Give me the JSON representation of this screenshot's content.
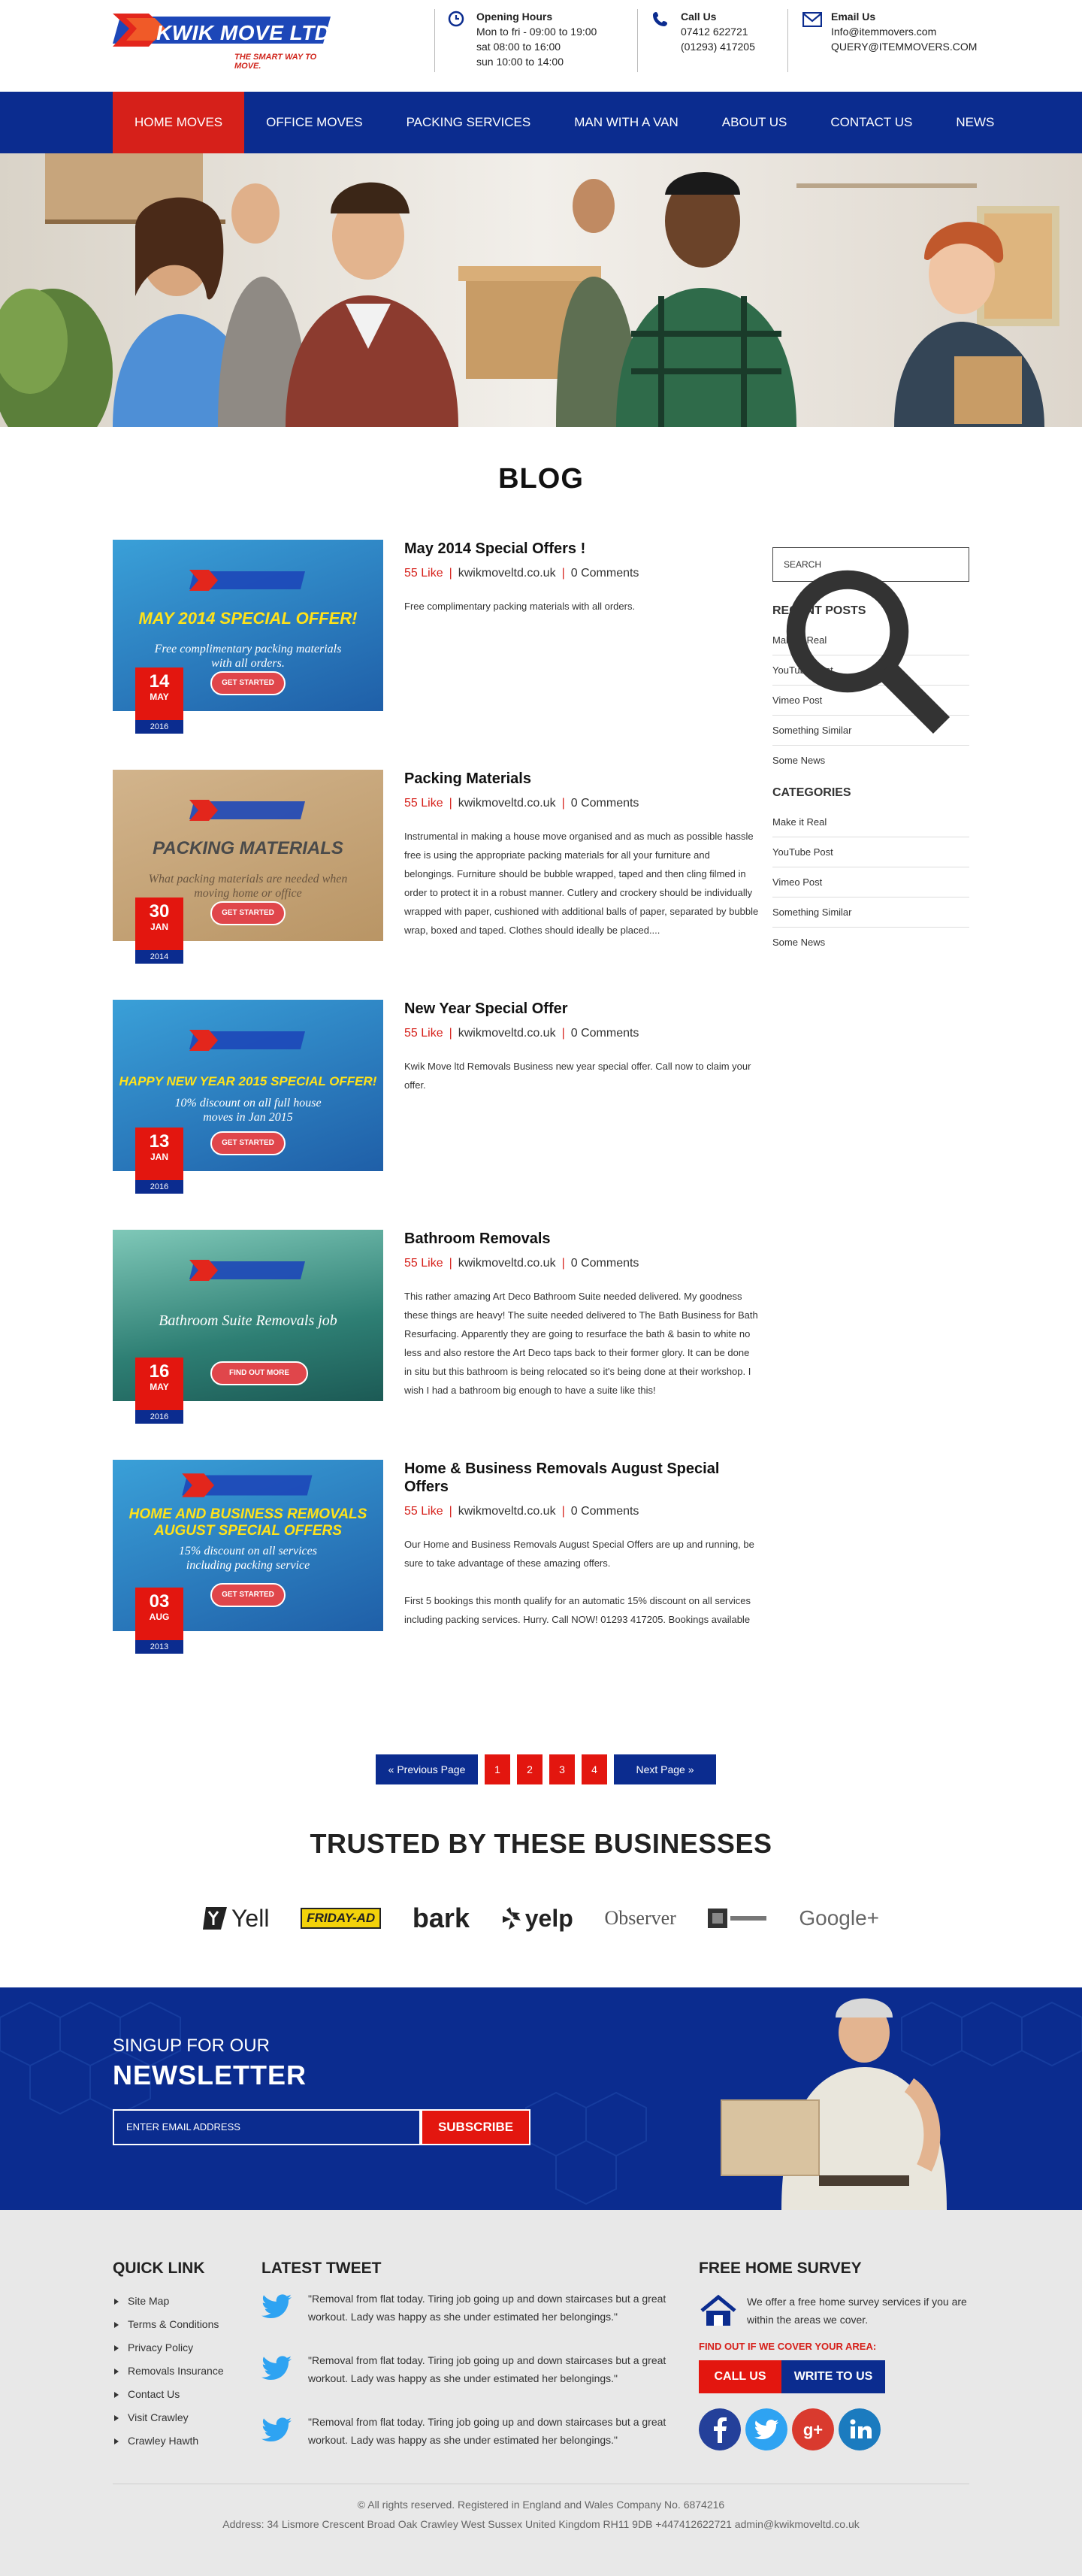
{
  "header": {
    "logo_text": "KWIK MOVE LTD",
    "logo_tagline": "THE SMART WAY TO MOVE.",
    "hours": {
      "title": "Opening Hours",
      "lines": [
        "Mon to fri - 09:00  to 19:00",
        "sat 08:00  to 16:00",
        "sun 10:00 to 14:00"
      ]
    },
    "call": {
      "title": "Call Us",
      "lines": [
        "07412 622721",
        "(01293) 417205"
      ]
    },
    "email": {
      "title": "Email Us",
      "lines": [
        "Info@itemmovers.com",
        "QUERY@ITEMMOVERS.COM"
      ]
    }
  },
  "nav": [
    "HOME MOVES",
    "OFFICE MOVES",
    "PACKING SERVICES",
    "MAN WITH A VAN",
    "ABOUT US",
    "CONTACT US",
    "NEWS"
  ],
  "blog_title": "BLOG",
  "posts": [
    {
      "title": "May 2014 Special Offers !",
      "likes": "55 Like",
      "site": "kwikmoveltd.co.uk",
      "comments": "0 Comments",
      "excerpt": "Free complimentary packing materials with all orders.",
      "img_logo": "KWIK MOVE LTD",
      "img_headline": "MAY 2014 SPECIAL OFFER!",
      "img_sub": "Free complimentary packing materials with all orders.",
      "img_cta": "GET STARTED",
      "day": "14",
      "month": "MAY",
      "year": "2016"
    },
    {
      "title": "Packing Materials",
      "likes": "55 Like",
      "site": "kwikmoveltd.co.uk",
      "comments": "0 Comments",
      "excerpt": "Instrumental in making a house move organised and as much as possible hassle free is using the appropriate packing materials for all your furniture and belongings. Furniture should be bubble wrapped, taped and then cling filmed in order to protect it in a robust manner. Cutlery and crockery should be individually wrapped with paper, cushioned with additional balls of paper, separated by bubble wrap, boxed and taped. Clothes should ideally be placed....",
      "img_logo": "KWIK MOVE LTD",
      "img_headline": "PACKING MATERIALS",
      "img_sub": "What packing materials are needed when moving home or office",
      "img_cta": "GET STARTED",
      "day": "30",
      "month": "JAN",
      "year": "2014"
    },
    {
      "title": "New Year Special Offer",
      "likes": "55 Like",
      "site": "kwikmoveltd.co.uk",
      "comments": "0 Comments",
      "excerpt": "Kwik Move ltd Removals Business new year special offer. Call now to claim your offer.",
      "img_logo": "KWIK MOVE LTD",
      "img_headline": "HAPPY NEW YEAR 2015 SPECIAL OFFER!",
      "img_sub": "10% discount on all full house moves in Jan 2015",
      "img_cta": "GET STARTED",
      "day": "13",
      "month": "JAN",
      "year": "2016"
    },
    {
      "title": "Bathroom Removals",
      "likes": "55 Like",
      "site": "kwikmoveltd.co.uk",
      "comments": "0 Comments",
      "excerpt": "This rather amazing Art Deco Bathroom Suite needed delivered. My goodness these things are heavy! The suite needed delivered to The Bath Business for Bath Resurfacing. Apparently they are going to resurface the bath & basin to white no less and also restore the Art Deco taps back to their former glory. It can be done in situ but this bathroom is being relocated so it's being done at their workshop. I wish I had a bathroom big enough to have a suite like this!",
      "img_logo": "KWIK MOVE LTD",
      "img_headline": "",
      "img_sub": "Bathroom Suite Removals job",
      "img_cta": "FIND OUT MORE",
      "day": "16",
      "month": "MAY",
      "year": "2016"
    },
    {
      "title": "Home & Business Removals August Special Offers",
      "likes": "55 Like",
      "site": "kwikmoveltd.co.uk",
      "comments": "0 Comments",
      "excerpt": "Our Home and Business Removals August Special Offers are up and running, be sure to take advantage of these amazing offers.",
      "excerpt2": "First 5 bookings this month qualify for an automatic 15% discount on all services including packing services. Hurry. Call NOW! 01293 417205. Bookings available",
      "img_logo": "KWIK MOVE LTD",
      "img_headline": "HOME AND BUSINESS REMOVALS AUGUST SPECIAL OFFERS",
      "img_sub": "15% discount on all services including packing service",
      "img_cta": "GET STARTED",
      "day": "03",
      "month": "AUG",
      "year": "2013"
    }
  ],
  "sidebar": {
    "search_placeholder": "SEARCH",
    "recent_title": "RECENT POSTS",
    "recent": [
      "Make it Real",
      "YouTube Post",
      "Vimeo Post",
      "Something Similar",
      "Some News"
    ],
    "categories_title": "CATEGORIES",
    "categories": [
      "Make it Real",
      "YouTube Post",
      "Vimeo Post",
      "Something Similar",
      "Some News"
    ]
  },
  "pager": {
    "prev": "Previous Page",
    "pages": [
      "1",
      "2",
      "3",
      "4"
    ],
    "next": "Next Page"
  },
  "trusted_title": "TRUSTED BY THESE BUSINESSES",
  "brands": [
    "Yell",
    "FRIDAY-AD",
    "bark",
    "yelp",
    "Observer",
    "",
    "Google+"
  ],
  "newsletter": {
    "pre": "SINGUP FOR OUR",
    "title": "NEWSLETTER",
    "placeholder": "ENTER EMAIL ADDRESS",
    "button": "SUBSCRIBE"
  },
  "footer": {
    "quick_title": "QUICK LINK",
    "quick": [
      "Site Map",
      "Terms & Conditions",
      "Privacy Policy",
      "Removals Insurance",
      "Contact Us",
      "Visit Crawley",
      "Crawley Hawth"
    ],
    "tweet_title": "LATEST TWEET",
    "tweets": [
      "\"Removal from flat today. Tiring job going up and down staircases but a great workout. Lady was happy as she under estimated her belongings.\"",
      "\"Removal from flat today. Tiring job going up and down staircases but a great workout. Lady was happy as she under estimated her belongings.\"",
      "\"Removal from flat today. Tiring job going up and down staircases but a great workout. Lady was happy as she under estimated her belongings.\""
    ],
    "survey_title": "FREE HOME SURVEY",
    "survey_text": "We offer a free home survey services if you are within the areas we cover.",
    "find_out": "FIND OUT IF WE COVER YOUR AREA:",
    "call_btn": "CALL US",
    "write_btn": "WRITE TO US",
    "copyright": "© All rights reserved. Registered in England and Wales Company No. 6874216",
    "address": "Address: 34 Lismore Crescent Broad Oak Crawley West Sussex United Kingdom RH11 9DB +447412622721 admin@kwikmoveltd.co.uk"
  },
  "colors": {
    "brand_blue": "#0b2c8f",
    "brand_red": "#e3160f",
    "nav_active": "#d6201a"
  }
}
